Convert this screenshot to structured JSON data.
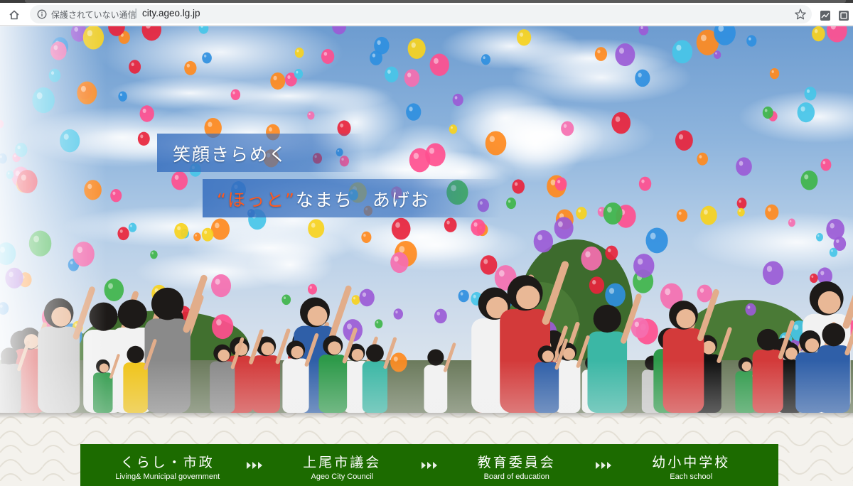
{
  "browser": {
    "security_text": "保護されていない通信",
    "separator": "|",
    "url": "city.ageo.lg.jp"
  },
  "hero": {
    "slogan_line1": "笑顔きらめく",
    "slogan_line2_accent": "“ほっと”",
    "slogan_line2_rest": "なまち　あげお"
  },
  "nav": {
    "items": [
      {
        "label": "くらし・市政",
        "sublabel": "Living& Municipal government"
      },
      {
        "label": "上尾市議会",
        "sublabel": "Ageo City Council"
      },
      {
        "label": "教育委員会",
        "sublabel": "Board of education"
      },
      {
        "label": "幼小中学校",
        "sublabel": "Each school"
      }
    ]
  },
  "colors": {
    "nav_bg": "#1c6b00",
    "slogan_accent": "#ff5a1f",
    "slogan_band": "#366ebe"
  }
}
